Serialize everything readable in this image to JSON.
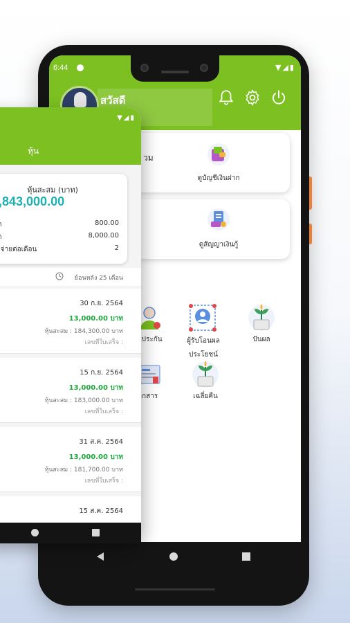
{
  "status_bar": {
    "time": "6:44"
  },
  "back_screen": {
    "greeting": "สวัสดี",
    "menu_cards": [
      {
        "stub": "วม",
        "label": "ดูบัญชีเงินฝาก"
      },
      {
        "stub": "",
        "label": "ดูสัญญาเงินกู้"
      }
    ],
    "grid_items": [
      {
        "label": "ำประกัน"
      },
      {
        "label": "ผู้รับโอนผลประโยชน์"
      },
      {
        "label": "ปันผล"
      },
      {
        "label": "อกสาร"
      },
      {
        "label": "เฉลี่ยคืน"
      }
    ],
    "icons": [
      "bell-icon",
      "gear-icon",
      "power-icon"
    ]
  },
  "front_screen": {
    "title": "หุ้น",
    "summary": {
      "label": "หุ้นสะสม (บาท)",
      "value": ",843,000.00",
      "rows": [
        {
          "key": "อด",
          "value": "800.00"
        },
        {
          "key": "อด",
          "value": "8,000.00"
        },
        {
          "key": "ระจ่ายต่อเดือน",
          "value": "2"
        }
      ]
    },
    "history_label": "ย้อนหลัง 25 เดือน",
    "transactions": [
      {
        "date": "30 ก.ย. 2564",
        "amount": "13,000.00 บาท",
        "accumulated": "หุ้นสะสม : 184,300.00 บาท",
        "receipt": "เลขที่ใบเสร็จ :"
      },
      {
        "date": "15 ก.ย. 2564",
        "amount": "13,000.00 บาท",
        "accumulated": "หุ้นสะสม : 183,000.00 บาท",
        "receipt": "เลขที่ใบเสร็จ :"
      },
      {
        "date": "31 ส.ค. 2564",
        "amount": "13,000.00 บาท",
        "accumulated": "หุ้นสะสม : 181,700.00 บาท",
        "receipt": "เลขที่ใบเสร็จ :"
      },
      {
        "date": "15 ส.ค. 2564"
      }
    ]
  },
  "colors": {
    "brand_green": "#7cc022",
    "amount_green": "#1ea83c",
    "teal": "#1fb0b3"
  }
}
